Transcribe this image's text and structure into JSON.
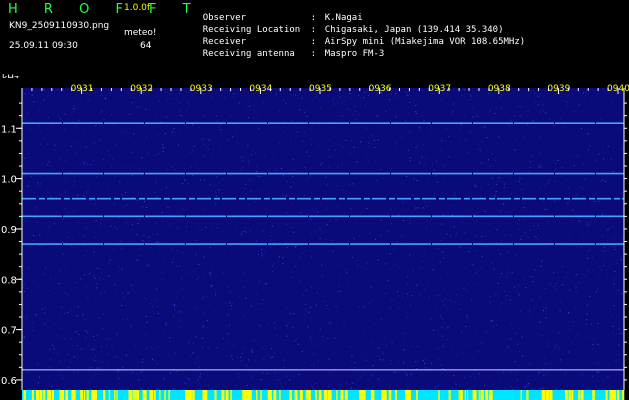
{
  "header": {
    "app_title": "H R O F F T",
    "version": "1.0.0f",
    "filename": "KN9_2509110930.png",
    "datetime": "25.09.11 09:30",
    "station": "meteo!",
    "count": "64",
    "meta": [
      {
        "label": "Observer",
        "value": "K.Nagai"
      },
      {
        "label": "Receiving Location",
        "value": "Chigasaki, Japan (139.414 35.340)"
      },
      {
        "label": "Receiver",
        "value": "AirSpy mini (Miakejima VOR 108.65MHz)"
      },
      {
        "label": "Receiving antenna",
        "value": "Maspro FM-3"
      }
    ]
  },
  "chart_data": {
    "type": "heatmap",
    "ylabel": "kHz",
    "ylim": [
      0.58,
      1.18
    ],
    "yticks": [
      "1.1",
      "1.0",
      "0.9",
      "0.8",
      "0.7",
      "0.6"
    ],
    "ytick_values": [
      1.1,
      1.0,
      0.9,
      0.8,
      0.7,
      0.6
    ],
    "x_ticks": [
      "0931",
      "0932",
      "0933",
      "0934",
      "0935",
      "0936",
      "0937",
      "0938",
      "0939",
      "0940"
    ],
    "x_tick_minutes": [
      1,
      2,
      3,
      4,
      5,
      6,
      7,
      8,
      9,
      10
    ],
    "x_range_minutes": [
      0,
      10.1
    ],
    "signal_lines_khz": [
      1.11,
      1.01,
      0.96,
      0.925,
      0.87
    ],
    "reference_line_khz": 0.62,
    "colors": {
      "background": "#0a0a7a",
      "signal": "#4aa0ff",
      "axis": "#ffffff",
      "tick_label": "#ffff00",
      "bottom_strip": "#00e5ff",
      "bottom_marker": "#ffff00"
    }
  }
}
